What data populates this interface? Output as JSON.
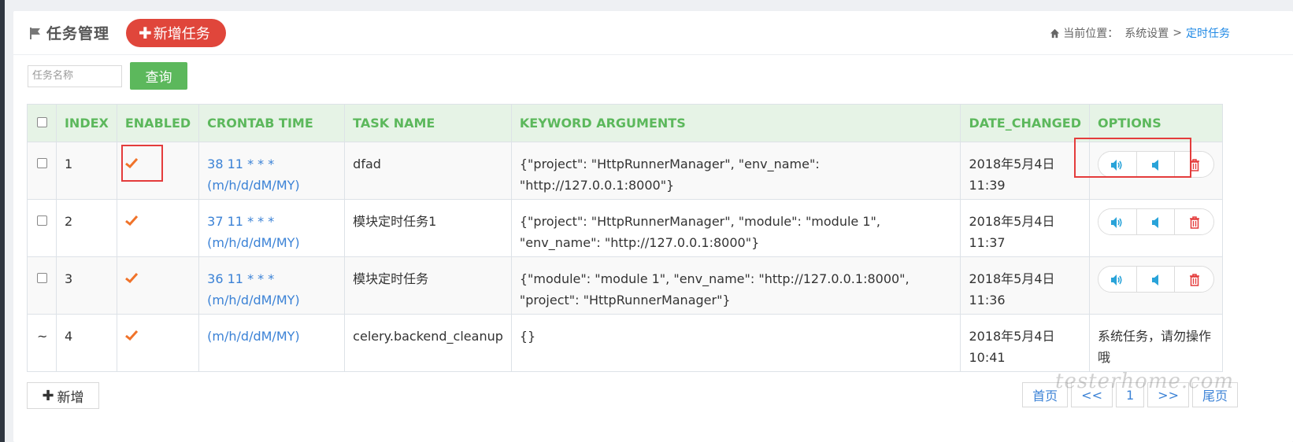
{
  "header": {
    "title": "任务管理",
    "add_task_label": "新增任务",
    "breadcrumb": {
      "prefix": "当前位置：",
      "parent": "系统设置",
      "separator": ">",
      "current": "定时任务"
    }
  },
  "search": {
    "placeholder": "任务名称",
    "value": "",
    "query_label": "查询"
  },
  "table": {
    "columns": [
      "INDEX",
      "ENABLED",
      "CRONTAB TIME",
      "TASK NAME",
      "KEYWORD ARGUMENTS",
      "DATE_CHANGED",
      "OPTIONS"
    ],
    "rows": [
      {
        "index": "1",
        "enabled": true,
        "cron_line1": "38 11 * * *",
        "cron_line2": "(m/h/d/dM/MY)",
        "task_name": "dfad",
        "kwargs": "{\"project\": \"HttpRunnerManager\", \"env_name\": \"http://127.0.0.1:8000\"}",
        "date_line1": "2018年5月4日",
        "date_line2": "11:39"
      },
      {
        "index": "2",
        "enabled": true,
        "cron_line1": "37 11 * * *",
        "cron_line2": "(m/h/d/dM/MY)",
        "task_name": "模块定时任务1",
        "kwargs": "{\"project\": \"HttpRunnerManager\", \"module\": \"module 1\", \"env_name\": \"http://127.0.0.1:8000\"}",
        "date_line1": "2018年5月4日",
        "date_line2": "11:37"
      },
      {
        "index": "3",
        "enabled": true,
        "cron_line1": "36 11 * * *",
        "cron_line2": "(m/h/d/dM/MY)",
        "task_name": "模块定时任务",
        "kwargs": "{\"module\": \"module 1\", \"env_name\": \"http://127.0.0.1:8000\", \"project\": \"HttpRunnerManager\"}",
        "date_line1": "2018年5月4日",
        "date_line2": "11:36"
      },
      {
        "check_symbol": "~",
        "index": "4",
        "enabled": true,
        "cron_line1": "(m/h/d/dM/MY)",
        "task_name": "celery.backend_cleanup",
        "kwargs": "{}",
        "date_line1": "2018年5月4日",
        "date_line2": "10:41",
        "options_text": "系统任务，请勿操作哦"
      }
    ]
  },
  "footer": {
    "add_label": "新增",
    "pager": {
      "first": "首页",
      "prev": "<<",
      "page": "1",
      "next": ">>",
      "last": "尾页"
    }
  },
  "watermark": "testerhome.com",
  "colors": {
    "accent_red": "#e0463b",
    "accent_green": "#5cb85c",
    "link_blue": "#3b82d6",
    "check_orange": "#f0732a",
    "annotation_red": "#e43c3c"
  }
}
